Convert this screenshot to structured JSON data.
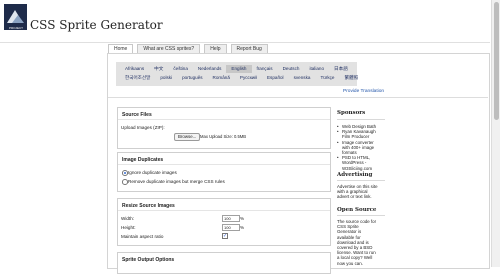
{
  "logo": {
    "line1": "PROJECT",
    "line2": "FONDUE"
  },
  "header": {
    "title": "CSS Sprite Generator"
  },
  "tabs": [
    "Home",
    "What are CSS sprites?",
    "Help",
    "Report Bug"
  ],
  "languages": {
    "row1": [
      "Afrikaans",
      "中文",
      "čeština",
      "Nederlands",
      "English",
      "français",
      "Deutsch",
      "italiano",
      "日本語"
    ],
    "row2": [
      "한국어조선말",
      "polski",
      "português",
      "Română",
      "Русский",
      "Español",
      "svenska",
      "Türkçe",
      "繁體照"
    ],
    "selected": "English",
    "provide_link": "Provide Translation"
  },
  "source_files": {
    "heading": "Source Files",
    "upload_label": "Upload Images (ZIP):",
    "browse_button": "Browse...",
    "max_size": "Max Upload Size: 0.5MB"
  },
  "duplicates": {
    "heading": "Image Duplicates",
    "option_ignore": "Ignore duplicate images",
    "option_remove": "Remove duplicate images but merge CSS rules"
  },
  "resize": {
    "heading": "Resize Source Images",
    "width_label": "Width:",
    "width_value": "100",
    "height_label": "Height:",
    "height_value": "100",
    "unit": "%",
    "aspect_label": "Maintain aspect ratio"
  },
  "output": {
    "heading": "Sprite Output Options"
  },
  "sidebar": {
    "sponsors_heading": "Sponsors",
    "sponsors": [
      "Web Design Bath",
      "Ryan Kavanaugh",
      "Film Producer",
      "Image converter",
      "with 400+ image",
      "formats",
      "PSD to HTML,",
      "WordPress -",
      "W3Sliciing.com"
    ],
    "advertising_heading": "Advertising",
    "advertising_text": [
      "Advertise on this site",
      "with a graphical",
      "advert or text link."
    ],
    "opensource_heading": "Open Source",
    "opensource_text": [
      "The source code for",
      "CSS Sprite",
      "Generator is",
      "available for",
      "download and is",
      "covered by a BSD",
      "license. Want to run",
      "a local copy? Well",
      "now you can."
    ]
  },
  "colors": {
    "language_bar": "#e2e2e2",
    "link": "#2255aa",
    "logo_bg": "#1e2b4a"
  }
}
